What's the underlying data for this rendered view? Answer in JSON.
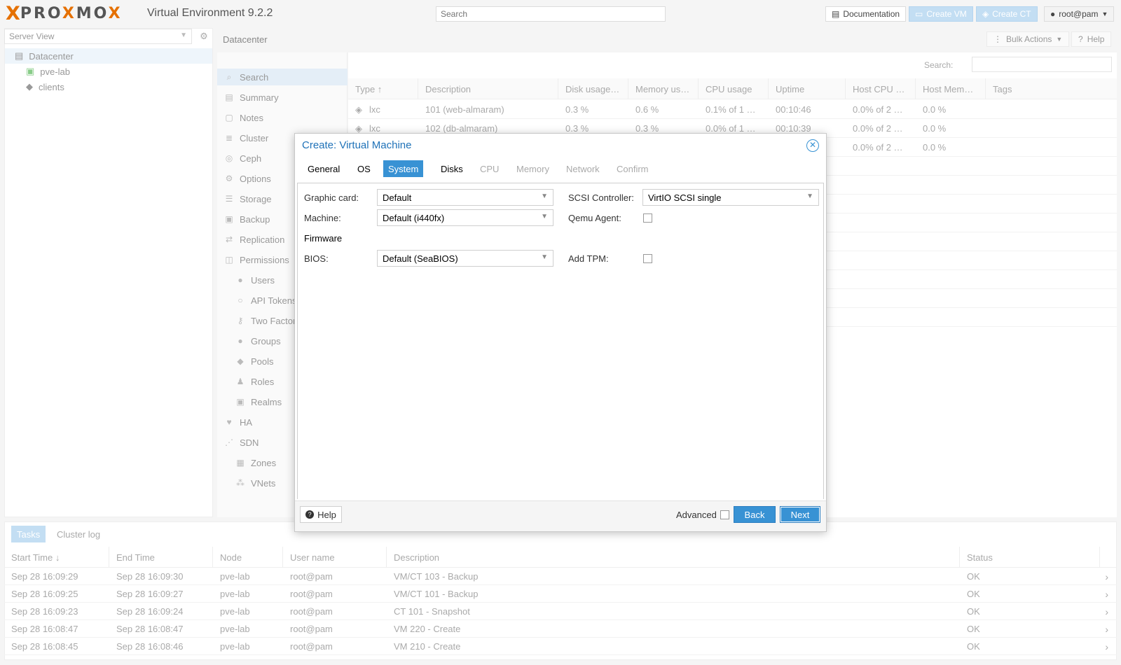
{
  "app": {
    "logo_x": "X",
    "logo_text_a": "PRO",
    "logo_text_b": "X",
    "logo_text_c": "MO",
    "logo_text_d": "X",
    "product": "Virtual Environment 9.2.2",
    "search_placeholder": "Search",
    "documentation": "Documentation",
    "create_vm": "Create VM",
    "create_ct": "Create CT",
    "user": "root@pam"
  },
  "server_view": {
    "selector": "Server View",
    "tree": [
      {
        "label": "Datacenter"
      },
      {
        "label": "pve-lab"
      },
      {
        "label": "clients"
      }
    ]
  },
  "center": {
    "breadcrumb": "Datacenter",
    "bulk_actions": "Bulk Actions",
    "help": "Help",
    "search_label": "Search:",
    "nav": [
      {
        "label": "Search",
        "icon": "search-icon"
      },
      {
        "label": "Summary",
        "icon": "book-icon"
      },
      {
        "label": "Notes",
        "icon": "note-icon"
      },
      {
        "label": "Cluster",
        "icon": "server-icon"
      },
      {
        "label": "Ceph",
        "icon": "ceph-icon"
      },
      {
        "label": "Options",
        "icon": "gear-icon"
      },
      {
        "label": "Storage",
        "icon": "database-icon"
      },
      {
        "label": "Backup",
        "icon": "floppy-icon"
      },
      {
        "label": "Replication",
        "icon": "retweet-icon"
      },
      {
        "label": "Permissions",
        "icon": "unlock-icon"
      },
      {
        "label": "Users",
        "icon": "user-icon"
      },
      {
        "label": "API Tokens",
        "icon": "user-o-icon"
      },
      {
        "label": "Two Factor",
        "icon": "key-icon"
      },
      {
        "label": "Groups",
        "icon": "users-icon"
      },
      {
        "label": "Pools",
        "icon": "tags-icon"
      },
      {
        "label": "Roles",
        "icon": "male-icon"
      },
      {
        "label": "Realms",
        "icon": "address-book-icon"
      },
      {
        "label": "HA",
        "icon": "heartbeat-icon"
      },
      {
        "label": "SDN",
        "icon": "sdn-icon"
      },
      {
        "label": "Zones",
        "icon": "th-icon"
      },
      {
        "label": "VNets",
        "icon": "network-icon"
      }
    ],
    "columns": [
      "Type",
      "Description",
      "Disk usage…",
      "Memory us…",
      "CPU usage",
      "Uptime",
      "Host CPU …",
      "Host Mem…",
      "Tags"
    ],
    "rows": [
      {
        "type": "lxc",
        "description": "101 (web-almaram)",
        "disk": "0.3 %",
        "memory": "0.6 %",
        "cpu": "0.1% of 1 …",
        "uptime": "00:10:46",
        "host_cpu": "0.0% of 2 …",
        "host_mem": "0.0 %"
      },
      {
        "type": "lxc",
        "description": "102 (db-almaram)",
        "disk": "0.3 %",
        "memory": "0.3 %",
        "cpu": "0.0% of 1 …",
        "uptime": "00:10:39",
        "host_cpu": "0.0% of 2 …",
        "host_mem": "0.0 %"
      },
      {
        "type": "",
        "description": "",
        "disk": "",
        "memory": "",
        "cpu": "",
        "uptime": "",
        "host_cpu": "0.0% of 2 …",
        "host_mem": "0.0 %"
      }
    ]
  },
  "tasks": {
    "tabs": [
      "Tasks",
      "Cluster log"
    ],
    "columns": [
      "Start Time",
      "End Time",
      "Node",
      "User name",
      "Description",
      "Status"
    ],
    "rows": [
      {
        "start": "Sep 28 16:09:29",
        "end": "Sep 28 16:09:30",
        "node": "pve-lab",
        "user": "root@pam",
        "description": "VM/CT 103 - Backup",
        "status": "OK"
      },
      {
        "start": "Sep 28 16:09:25",
        "end": "Sep 28 16:09:27",
        "node": "pve-lab",
        "user": "root@pam",
        "description": "VM/CT 101 - Backup",
        "status": "OK"
      },
      {
        "start": "Sep 28 16:09:23",
        "end": "Sep 28 16:09:24",
        "node": "pve-lab",
        "user": "root@pam",
        "description": "CT 101 - Snapshot",
        "status": "OK"
      },
      {
        "start": "Sep 28 16:08:47",
        "end": "Sep 28 16:08:47",
        "node": "pve-lab",
        "user": "root@pam",
        "description": "VM 220 - Create",
        "status": "OK"
      },
      {
        "start": "Sep 28 16:08:45",
        "end": "Sep 28 16:08:46",
        "node": "pve-lab",
        "user": "root@pam",
        "description": "VM 210 - Create",
        "status": "OK"
      }
    ]
  },
  "dialog": {
    "title": "Create: Virtual Machine",
    "tabs": [
      {
        "label": "General",
        "state": "enabled"
      },
      {
        "label": "OS",
        "state": "enabled"
      },
      {
        "label": "System",
        "state": "active"
      },
      {
        "label": "Disks",
        "state": "enabled"
      },
      {
        "label": "CPU",
        "state": "disabled"
      },
      {
        "label": "Memory",
        "state": "disabled"
      },
      {
        "label": "Network",
        "state": "disabled"
      },
      {
        "label": "Confirm",
        "state": "disabled"
      }
    ],
    "fields": {
      "graphic_card_label": "Graphic card:",
      "graphic_card_value": "Default",
      "machine_label": "Machine:",
      "machine_value": "Default (i440fx)",
      "firmware_section": "Firmware",
      "bios_label": "BIOS:",
      "bios_value": "Default (SeaBIOS)",
      "scsi_label": "SCSI Controller:",
      "scsi_value": "VirtIO SCSI single",
      "qemu_agent_label": "Qemu Agent:",
      "qemu_agent_checked": false,
      "add_tpm_label": "Add TPM:",
      "add_tpm_checked": false
    },
    "footer": {
      "help": "Help",
      "advanced": "Advanced",
      "advanced_checked": false,
      "back": "Back",
      "next": "Next"
    }
  },
  "colors": {
    "accent": "#3892d4",
    "brand_orange": "#e57000",
    "title_blue": "#1f72b8"
  }
}
